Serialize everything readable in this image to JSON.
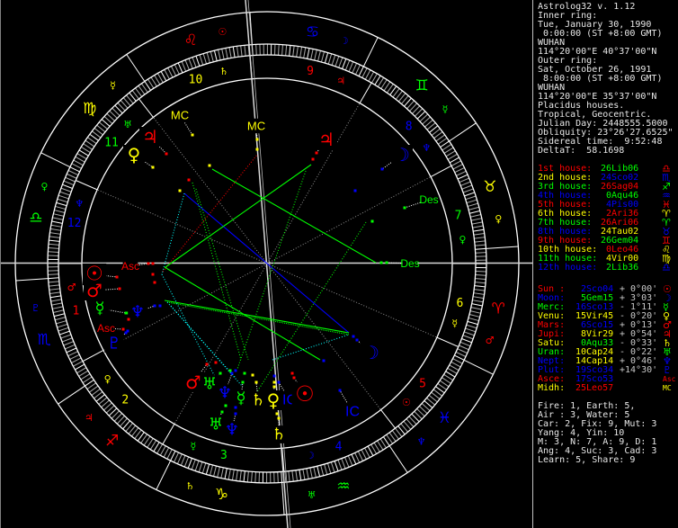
{
  "info": {
    "title": "Astrolog32 v. 1.12",
    "inner_label": "Inner ring:",
    "inner_date": "Tue, January 30, 1990",
    "inner_time": " 0:00:00 (ST +8:00 GMT)",
    "inner_place": "WUHAN",
    "inner_coords": "114°20'00\"E 40°37'00\"N",
    "outer_label": "Outer ring:",
    "outer_date": "Sat, October 26, 1991",
    "outer_time": " 8:00:00 (ST +8:00 GMT)",
    "outer_place": "WUHAN",
    "outer_coords": "114°20'00\"E 35°37'00\"N",
    "house_system": "Placidus houses.",
    "zodiac": "Tropical, Geocentric.",
    "julian_day": "Julian Day: 2448555.5000",
    "obliquity": "Obliquity: 23°26'27.6525\"",
    "sidereal": "Sidereal time:  9:52:48",
    "deltat": "DeltaT:  58.1698"
  },
  "houses": [
    {
      "label": "1st house:",
      "value": "26Lib06",
      "glyph": "♎",
      "lc": "r",
      "vc": "g",
      "gc": "r"
    },
    {
      "label": "2nd house:",
      "value": "24Sco02",
      "glyph": "♏",
      "lc": "y",
      "vc": "b",
      "gc": "b"
    },
    {
      "label": "3rd house:",
      "value": "26Sag04",
      "glyph": "♐",
      "lc": "g",
      "vc": "r",
      "gc": "g"
    },
    {
      "label": "4th house:",
      "value": " 0Aqu46",
      "glyph": "♒",
      "lc": "b",
      "vc": "g",
      "gc": "b"
    },
    {
      "label": "5th house:",
      "value": " 4Pis00",
      "glyph": "♓",
      "lc": "r",
      "vc": "b",
      "gc": "r"
    },
    {
      "label": "6th house:",
      "value": " 2Ari36",
      "glyph": "♈",
      "lc": "y",
      "vc": "r",
      "gc": "y"
    },
    {
      "label": "7th house:",
      "value": "26Ari06",
      "glyph": "♈",
      "lc": "g",
      "vc": "r",
      "gc": "g"
    },
    {
      "label": "8th house:",
      "value": "24Tau02",
      "glyph": "♉",
      "lc": "b",
      "vc": "y",
      "gc": "b"
    },
    {
      "label": "9th house:",
      "value": "26Gem04",
      "glyph": "♊",
      "lc": "r",
      "vc": "g",
      "gc": "r"
    },
    {
      "label": "10th house:",
      "value": " 0Leo46",
      "glyph": "♌",
      "lc": "y",
      "vc": "r",
      "gc": "y"
    },
    {
      "label": "11th house:",
      "value": " 4Vir00",
      "glyph": "♍",
      "lc": "g",
      "vc": "y",
      "gc": "y"
    },
    {
      "label": "12th house:",
      "value": " 2Lib36",
      "glyph": "♎",
      "lc": "b",
      "vc": "g",
      "gc": "b"
    }
  ],
  "planets": [
    {
      "label": "Sun :",
      "value": " 2Sco04",
      "aspect": "+ 0°00'",
      "glyph": "☉",
      "lc": "r",
      "vc": "b",
      "gc": "r"
    },
    {
      "label": "Moon:",
      "value": " 5Gem15",
      "aspect": "+ 3°03'",
      "glyph": "☽",
      "lc": "b",
      "vc": "g",
      "gc": "b"
    },
    {
      "label": "Merc:",
      "value": "16Sco13",
      "aspect": "- 1°11'",
      "glyph": "☿",
      "lc": "g",
      "vc": "b",
      "gc": "g"
    },
    {
      "label": "Venu:",
      "value": "15Vir45",
      "aspect": "- 0°20'",
      "glyph": "♀",
      "lc": "y",
      "vc": "y",
      "gc": "y"
    },
    {
      "label": "Mars:",
      "value": " 6Sco15",
      "aspect": "+ 0°13'",
      "glyph": "♂",
      "lc": "r",
      "vc": "b",
      "gc": "r"
    },
    {
      "label": "Jupi:",
      "value": " 8Vir29",
      "aspect": "+ 0°54'",
      "glyph": "♃",
      "lc": "r",
      "vc": "y",
      "gc": "r"
    },
    {
      "label": "Satu:",
      "value": " 0Aqu33",
      "aspect": "- 0°33'",
      "glyph": "♄",
      "lc": "y",
      "vc": "g",
      "gc": "y"
    },
    {
      "label": "Uran:",
      "value": "10Cap24",
      "aspect": "- 0°22'",
      "glyph": "♅",
      "lc": "g",
      "vc": "y",
      "gc": "g"
    },
    {
      "label": "Nept:",
      "value": "14Cap14",
      "aspect": "+ 0°46'",
      "glyph": "♆",
      "lc": "b",
      "vc": "y",
      "gc": "b"
    },
    {
      "label": "Plut:",
      "value": "19Sco34",
      "aspect": "+14°30'",
      "glyph": "♇",
      "lc": "b",
      "vc": "b",
      "gc": "b"
    },
    {
      "label": "Asce:",
      "value": "17Sco53",
      "aspect": "",
      "glyph": "Asc",
      "lc": "r",
      "vc": "b",
      "gc": "r"
    },
    {
      "label": "Midh:",
      "value": "25Leo57",
      "aspect": "",
      "glyph": "MC",
      "lc": "y",
      "vc": "r",
      "gc": "y"
    }
  ],
  "stats": [
    "Fire: 1, Earth: 5,",
    "Air : 3, Water: 5",
    "Car: 2, Fix: 9, Mut: 3",
    "Yang: 4, Yin: 10",
    "M: 3, N: 7, A: 9, D: 1",
    "Ang: 4, Suc: 3, Cad: 3",
    "Learn: 5, Share: 9"
  ],
  "wheel": {
    "signs": [
      "♈",
      "♉",
      "♊",
      "♋",
      "♌",
      "♍",
      "♎",
      "♏",
      "♐",
      "♑",
      "♒",
      "♓"
    ],
    "sign_rulers": [
      "♂",
      "♀",
      "☿",
      "☽",
      "☉",
      "☿",
      "♀",
      "♇",
      "♃",
      "♄",
      "♅",
      "♆"
    ],
    "house_numbers": [
      "1",
      "2",
      "3",
      "4",
      "5",
      "6",
      "7",
      "8",
      "9",
      "10",
      "11",
      "12"
    ],
    "house_rulers": [
      "♂",
      "♀",
      "☿",
      "☽",
      "☉",
      "☿",
      "♀",
      "♆",
      "♃",
      "♄",
      "♅",
      "♆"
    ],
    "house_cusps": [
      206.1,
      234.03,
      266.07,
      300.77,
      334.0,
      2.6,
      26.1,
      54.03,
      86.07,
      120.77,
      154.0,
      182.6
    ],
    "labels": {
      "asc": "Asc",
      "des": "Des",
      "mc": "MC",
      "ic": "IC"
    },
    "glyphs": {
      "sun": "☉",
      "moon": "☽",
      "mercury": "☿",
      "venus": "♀",
      "mars": "♂",
      "jupiter": "♃",
      "saturn": "♄",
      "uranus": "♅",
      "neptune": "♆",
      "pluto": "♇"
    },
    "colors": {
      "fire": "#ff0000",
      "earth": "#ffff00",
      "air": "#00ff00",
      "water": "#0000ff",
      "ring": "#ffffff",
      "tick": "#a8a8a8",
      "cusp": "#909090"
    }
  }
}
